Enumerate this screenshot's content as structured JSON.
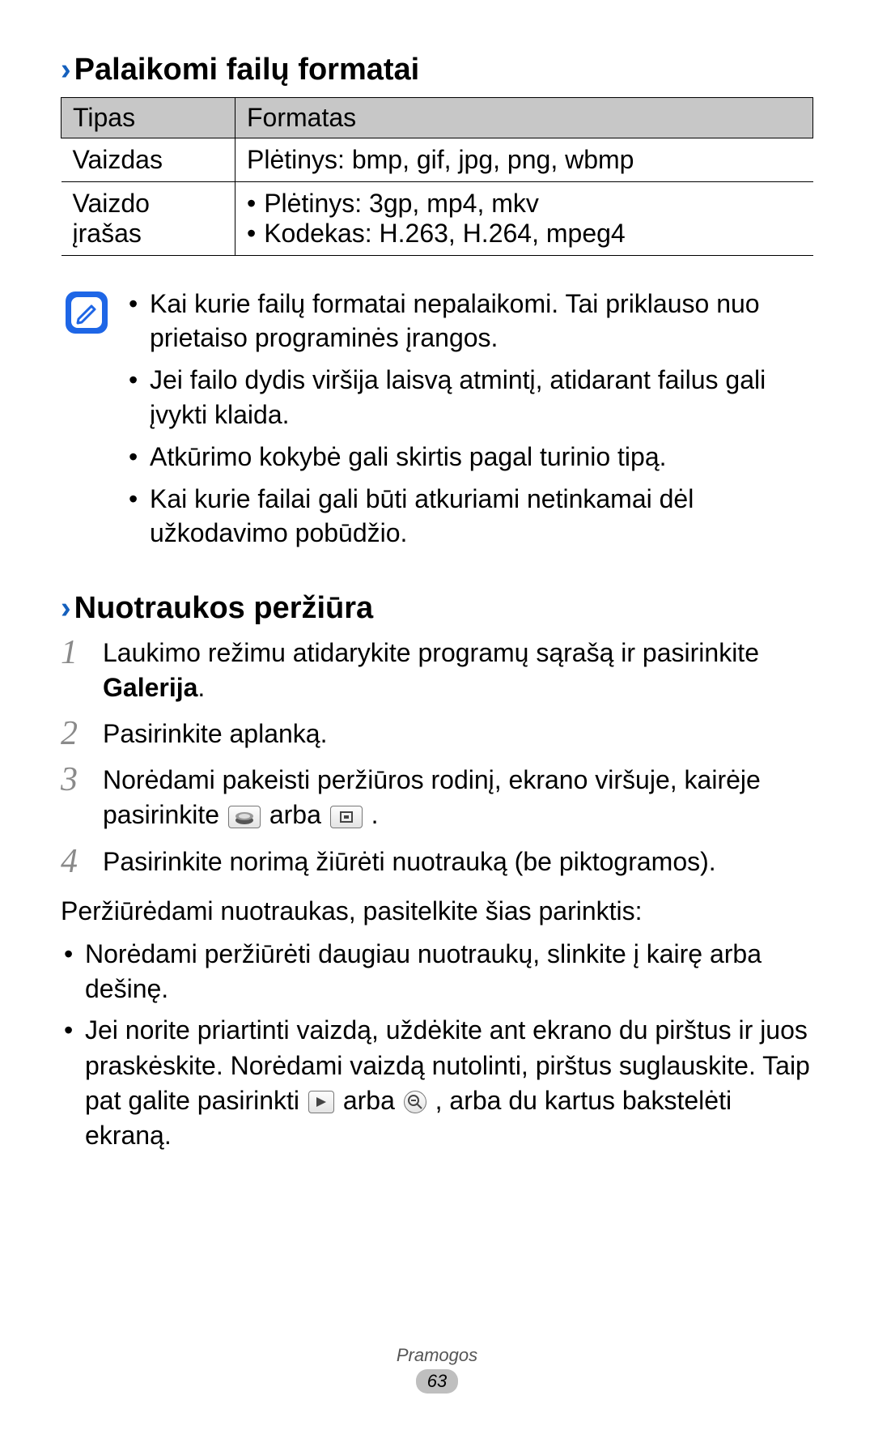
{
  "sections": {
    "supported_formats": {
      "heading": "Palaikomi failų formatai",
      "table": {
        "header_type": "Tipas",
        "header_format": "Formatas",
        "row_image": {
          "label": "Vaizdas",
          "value": "Plėtinys: bmp, gif, jpg, png, wbmp"
        },
        "row_video": {
          "label": "Vaizdo įrašas",
          "line1": "Plėtinys: 3gp, mp4, mkv",
          "line2": "Kodekas: H.263, H.264, mpeg4"
        }
      }
    },
    "notes": [
      "Kai kurie failų formatai nepalaikomi. Tai priklauso nuo prietaiso programinės įrangos.",
      "Jei failo dydis viršija laisvą atmintį, atidarant failus gali įvykti klaida.",
      "Atkūrimo kokybė gali skirtis pagal turinio tipą.",
      "Kai kurie failai gali būti atkuriami netinkamai dėl užkodavimo pobūdžio."
    ],
    "photo_review": {
      "heading": "Nuotraukos peržiūra",
      "step1_prefix": "Laukimo režimu atidarykite programų sąrašą ir pasirinkite ",
      "step1_bold": "Galerija",
      "step1_suffix": ".",
      "step2": "Pasirinkite aplanką.",
      "step3_a": "Norėdami pakeisti peržiūros rodinį, ekrano viršuje, kairėje pasirinkite ",
      "step3_mid": " arba ",
      "step3_end": ".",
      "step4": "Pasirinkite norimą žiūrėti nuotrauką (be piktogramos).",
      "intro_options": "Peržiūrėdami nuotraukas, pasitelkite šias parinktis:",
      "opt1": "Norėdami peržiūrėti daugiau nuotraukų, slinkite į kairę arba dešinę.",
      "opt2_a": "Jei norite priartinti vaizdą, uždėkite ant ekrano du pirštus ir juos praskėskite. Norėdami vaizdą nutolinti, pirštus suglauskite. Taip pat galite pasirinkti ",
      "opt2_mid": " arba ",
      "opt2_b": ", arba du kartus bakstelėti ekraną."
    }
  },
  "footer": {
    "category": "Pramogos",
    "page": "63"
  },
  "icons": {
    "note": "note-pencil-icon",
    "view_stack": "stack-view-icon",
    "view_grid": "grid-view-icon",
    "zoom_in": "zoom-in-icon",
    "zoom_out": "zoom-out-icon"
  }
}
